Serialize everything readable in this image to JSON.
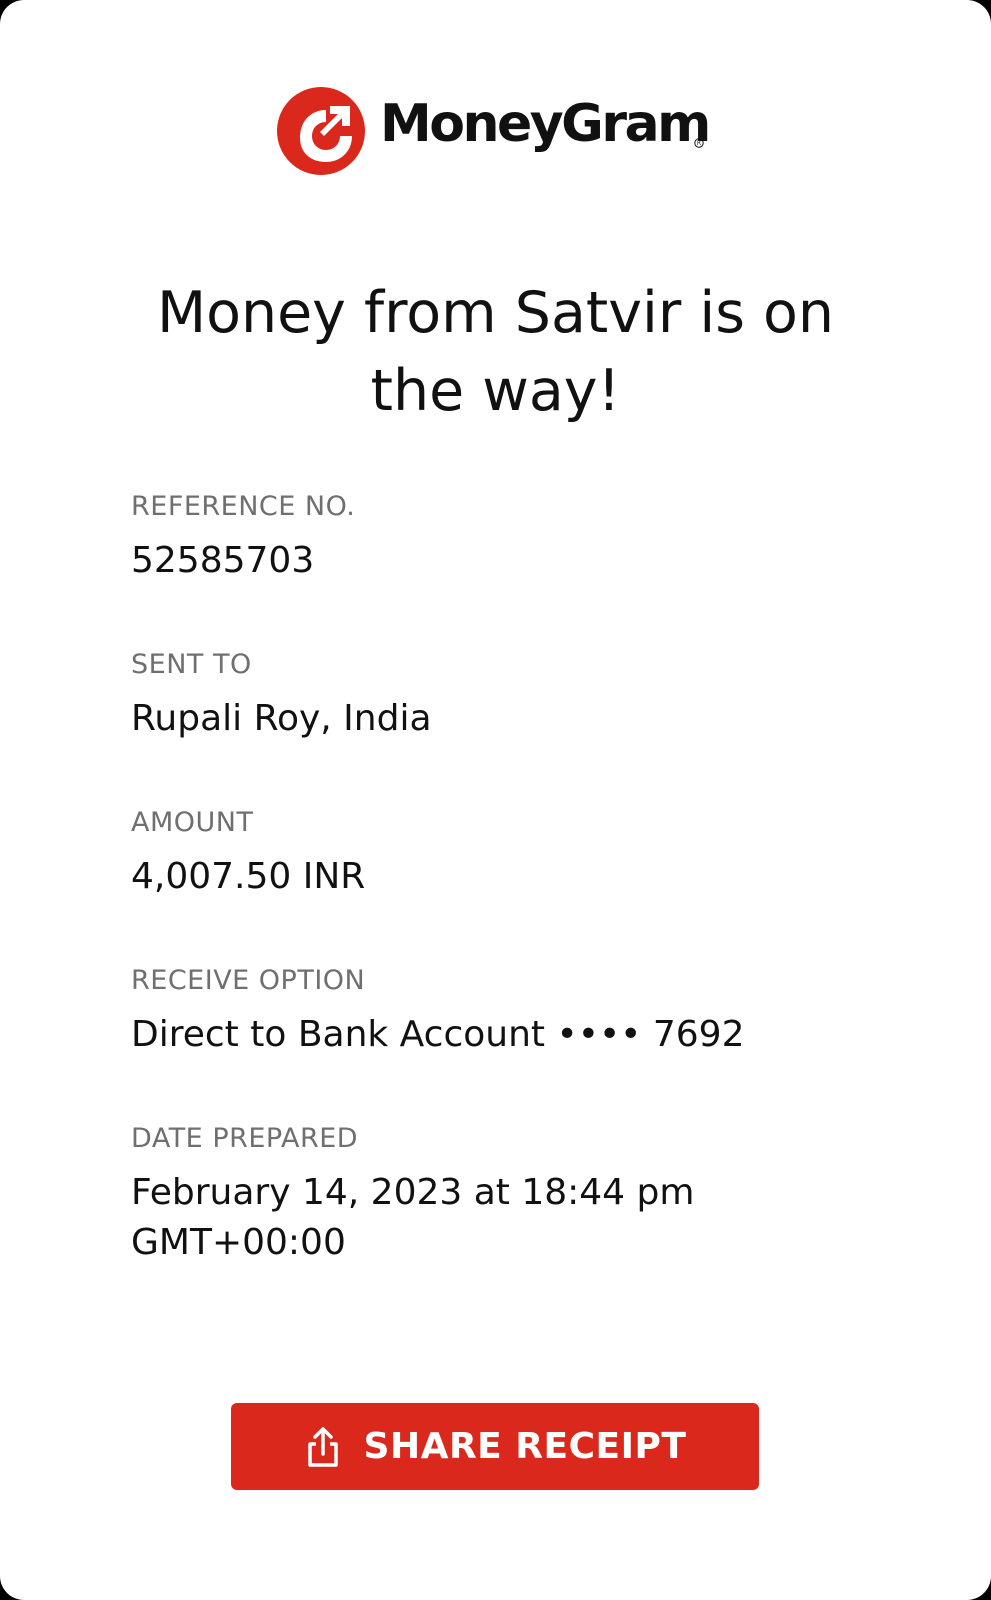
{
  "brand": {
    "name": "MoneyGram",
    "logo_icon": "moneygram-arrow-logo-icon",
    "registered_mark": "®",
    "accent_color": "#da291c"
  },
  "headline": "Money from Satvir is on the way!",
  "details": {
    "reference": {
      "label": "REFERENCE NO.",
      "value": "52585703"
    },
    "sent_to": {
      "label": "SENT TO",
      "value": "Rupali Roy, India"
    },
    "amount": {
      "label": "AMOUNT",
      "value": "4,007.50 INR"
    },
    "receive_option": {
      "label": "RECEIVE OPTION",
      "value": "Direct to Bank Account •••• 7692"
    },
    "date_prepared": {
      "label": "DATE PREPARED",
      "value_line1": "February 14, 2023 at 18:44 pm",
      "value_line2": "GMT+00:00"
    }
  },
  "share_button": {
    "label": "SHARE RECEIPT",
    "icon": "share-upload-icon"
  }
}
